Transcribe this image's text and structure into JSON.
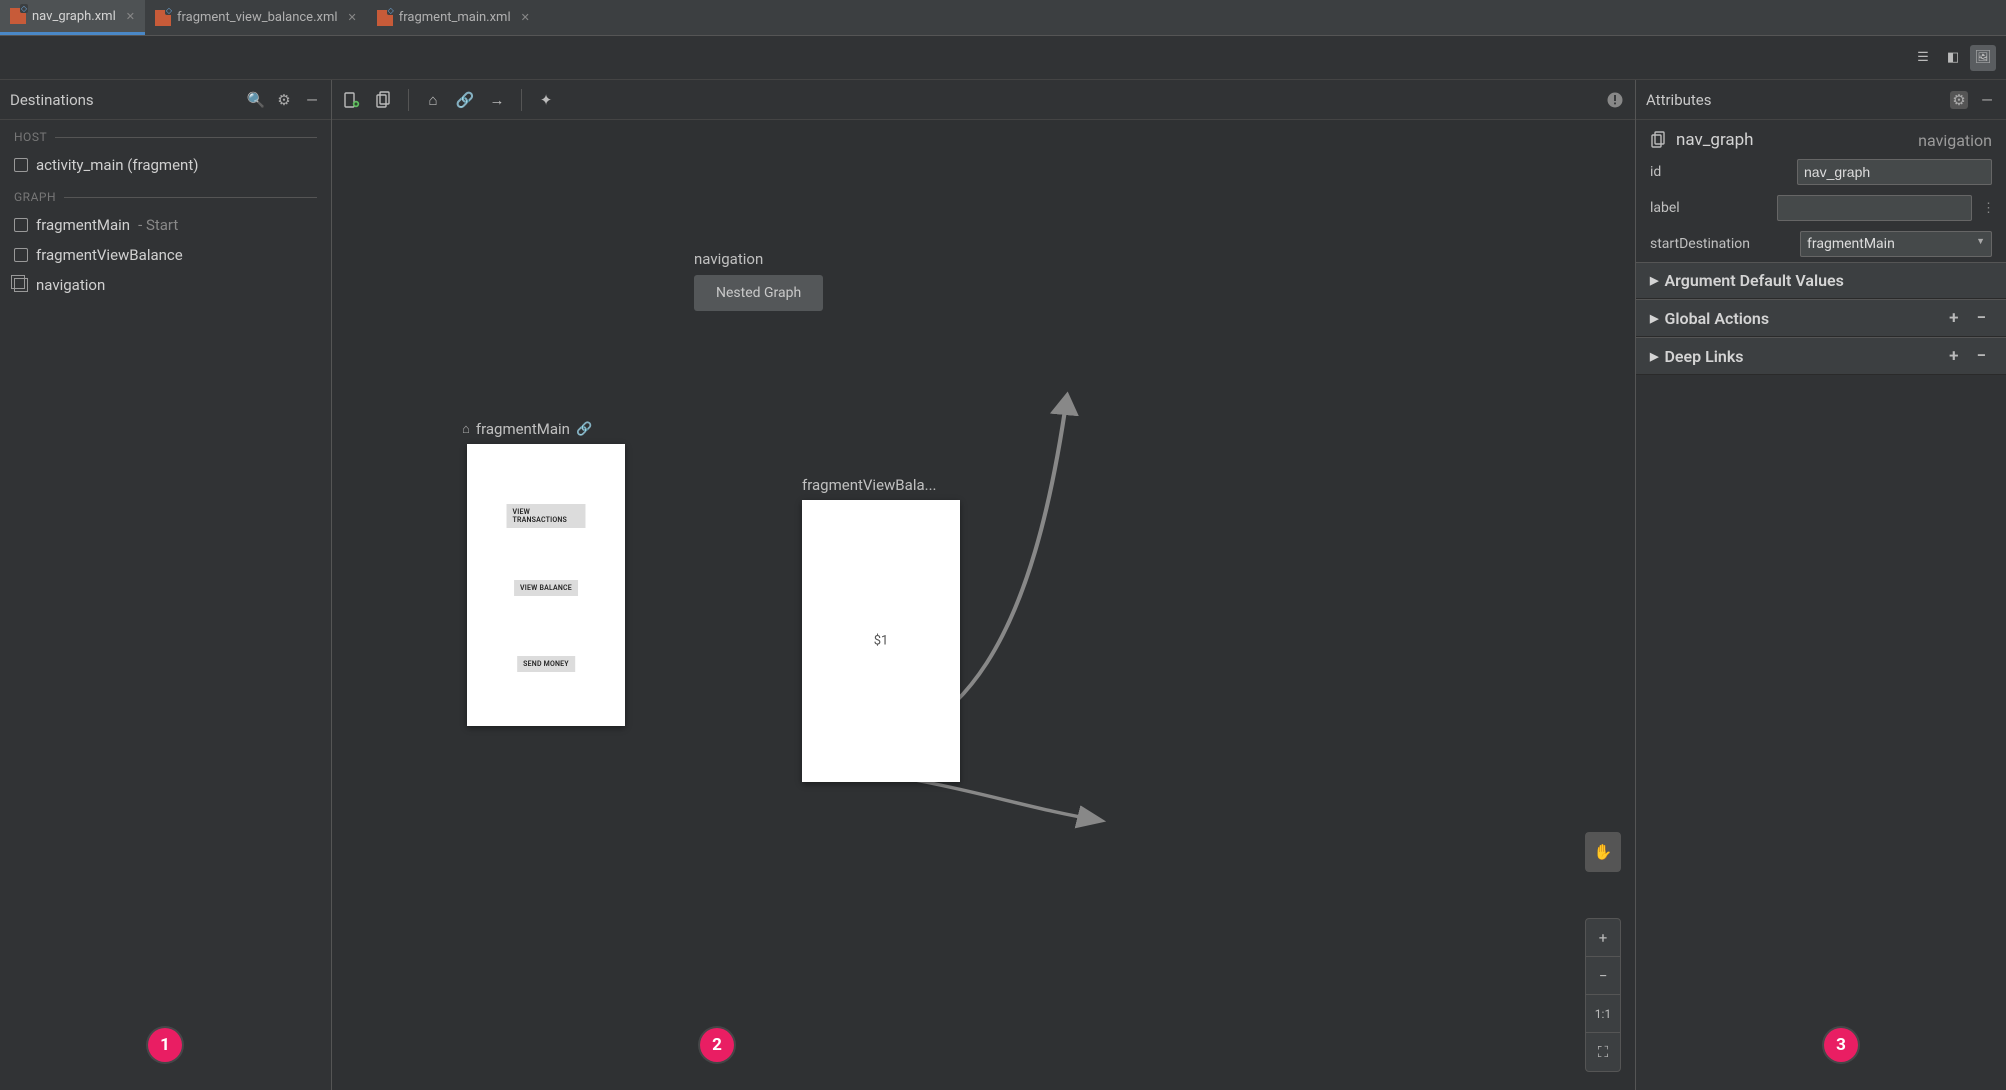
{
  "tabs": [
    {
      "label": "nav_graph.xml",
      "active": true
    },
    {
      "label": "fragment_view_balance.xml",
      "active": false
    },
    {
      "label": "fragment_main.xml",
      "active": false
    }
  ],
  "destinations": {
    "title": "Destinations",
    "host_label": "HOST",
    "graph_label": "GRAPH",
    "host_item": "activity_main (fragment)",
    "graph_items": [
      {
        "name": "fragmentMain",
        "suffix": " - Start"
      },
      {
        "name": "fragmentViewBalance",
        "suffix": ""
      },
      {
        "name": "navigation",
        "suffix": ""
      }
    ]
  },
  "canvas": {
    "nav_label": "navigation",
    "nested_label": "Nested Graph",
    "fragMain_title": "fragmentMain",
    "fragMain_buttons": [
      "VIEW TRANSACTIONS",
      "VIEW BALANCE",
      "SEND MONEY"
    ],
    "fragView_title": "fragmentViewBala...",
    "fragView_text": "$1"
  },
  "zoom": {
    "one": "1:1"
  },
  "attributes": {
    "title": "Attributes",
    "graph_name": "nav_graph",
    "graph_type": "navigation",
    "rows": {
      "id_label": "id",
      "id_value": "nav_graph",
      "label_label": "label",
      "label_value": "",
      "start_label": "startDestination",
      "start_value": "fragmentMain"
    },
    "sections": {
      "argdef": "Argument Default Values",
      "global": "Global Actions",
      "deep": "Deep Links"
    }
  },
  "bubbles": {
    "b1": "1",
    "b2": "2",
    "b3": "3"
  }
}
